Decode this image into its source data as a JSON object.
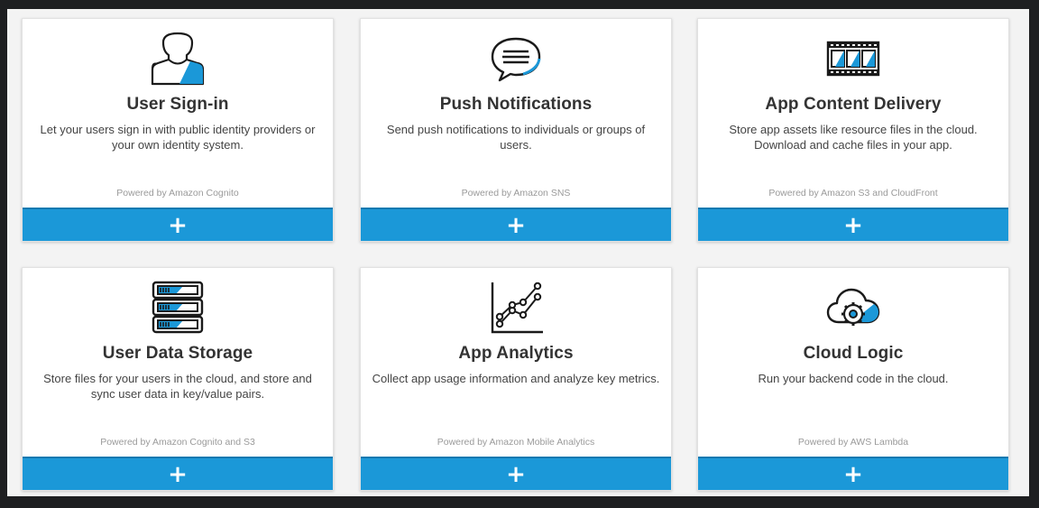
{
  "colors": {
    "accent": "#1b98d8",
    "accent_dark": "#1379b0",
    "icon_stroke": "#1a1a1a"
  },
  "cards": [
    {
      "icon": "user-silhouette-icon",
      "title": "User Sign-in",
      "description": "Let your users sign in with public identity providers or your own identity system.",
      "powered_by": "Powered by Amazon Cognito",
      "add_label": "+"
    },
    {
      "icon": "chat-bubble-icon",
      "title": "Push Notifications",
      "description": "Send push notifications to individuals or groups of users.",
      "powered_by": "Powered by Amazon SNS",
      "add_label": "+"
    },
    {
      "icon": "film-strip-icon",
      "title": "App Content Delivery",
      "description": "Store app assets like resource files in the cloud. Download and cache files in your app.",
      "powered_by": "Powered by Amazon S3 and CloudFront",
      "add_label": "+"
    },
    {
      "icon": "server-stack-icon",
      "title": "User Data Storage",
      "description": "Store files for your users in the cloud, and store and sync user data in key/value pairs.",
      "powered_by": "Powered by Amazon Cognito and S3",
      "add_label": "+"
    },
    {
      "icon": "line-graph-icon",
      "title": "App Analytics",
      "description": "Collect app usage information and analyze key metrics.",
      "powered_by": "Powered by Amazon Mobile Analytics",
      "add_label": "+"
    },
    {
      "icon": "cloud-gear-icon",
      "title": "Cloud Logic",
      "description": "Run your backend code in the cloud.",
      "powered_by": "Powered by AWS Lambda",
      "add_label": "+"
    }
  ]
}
